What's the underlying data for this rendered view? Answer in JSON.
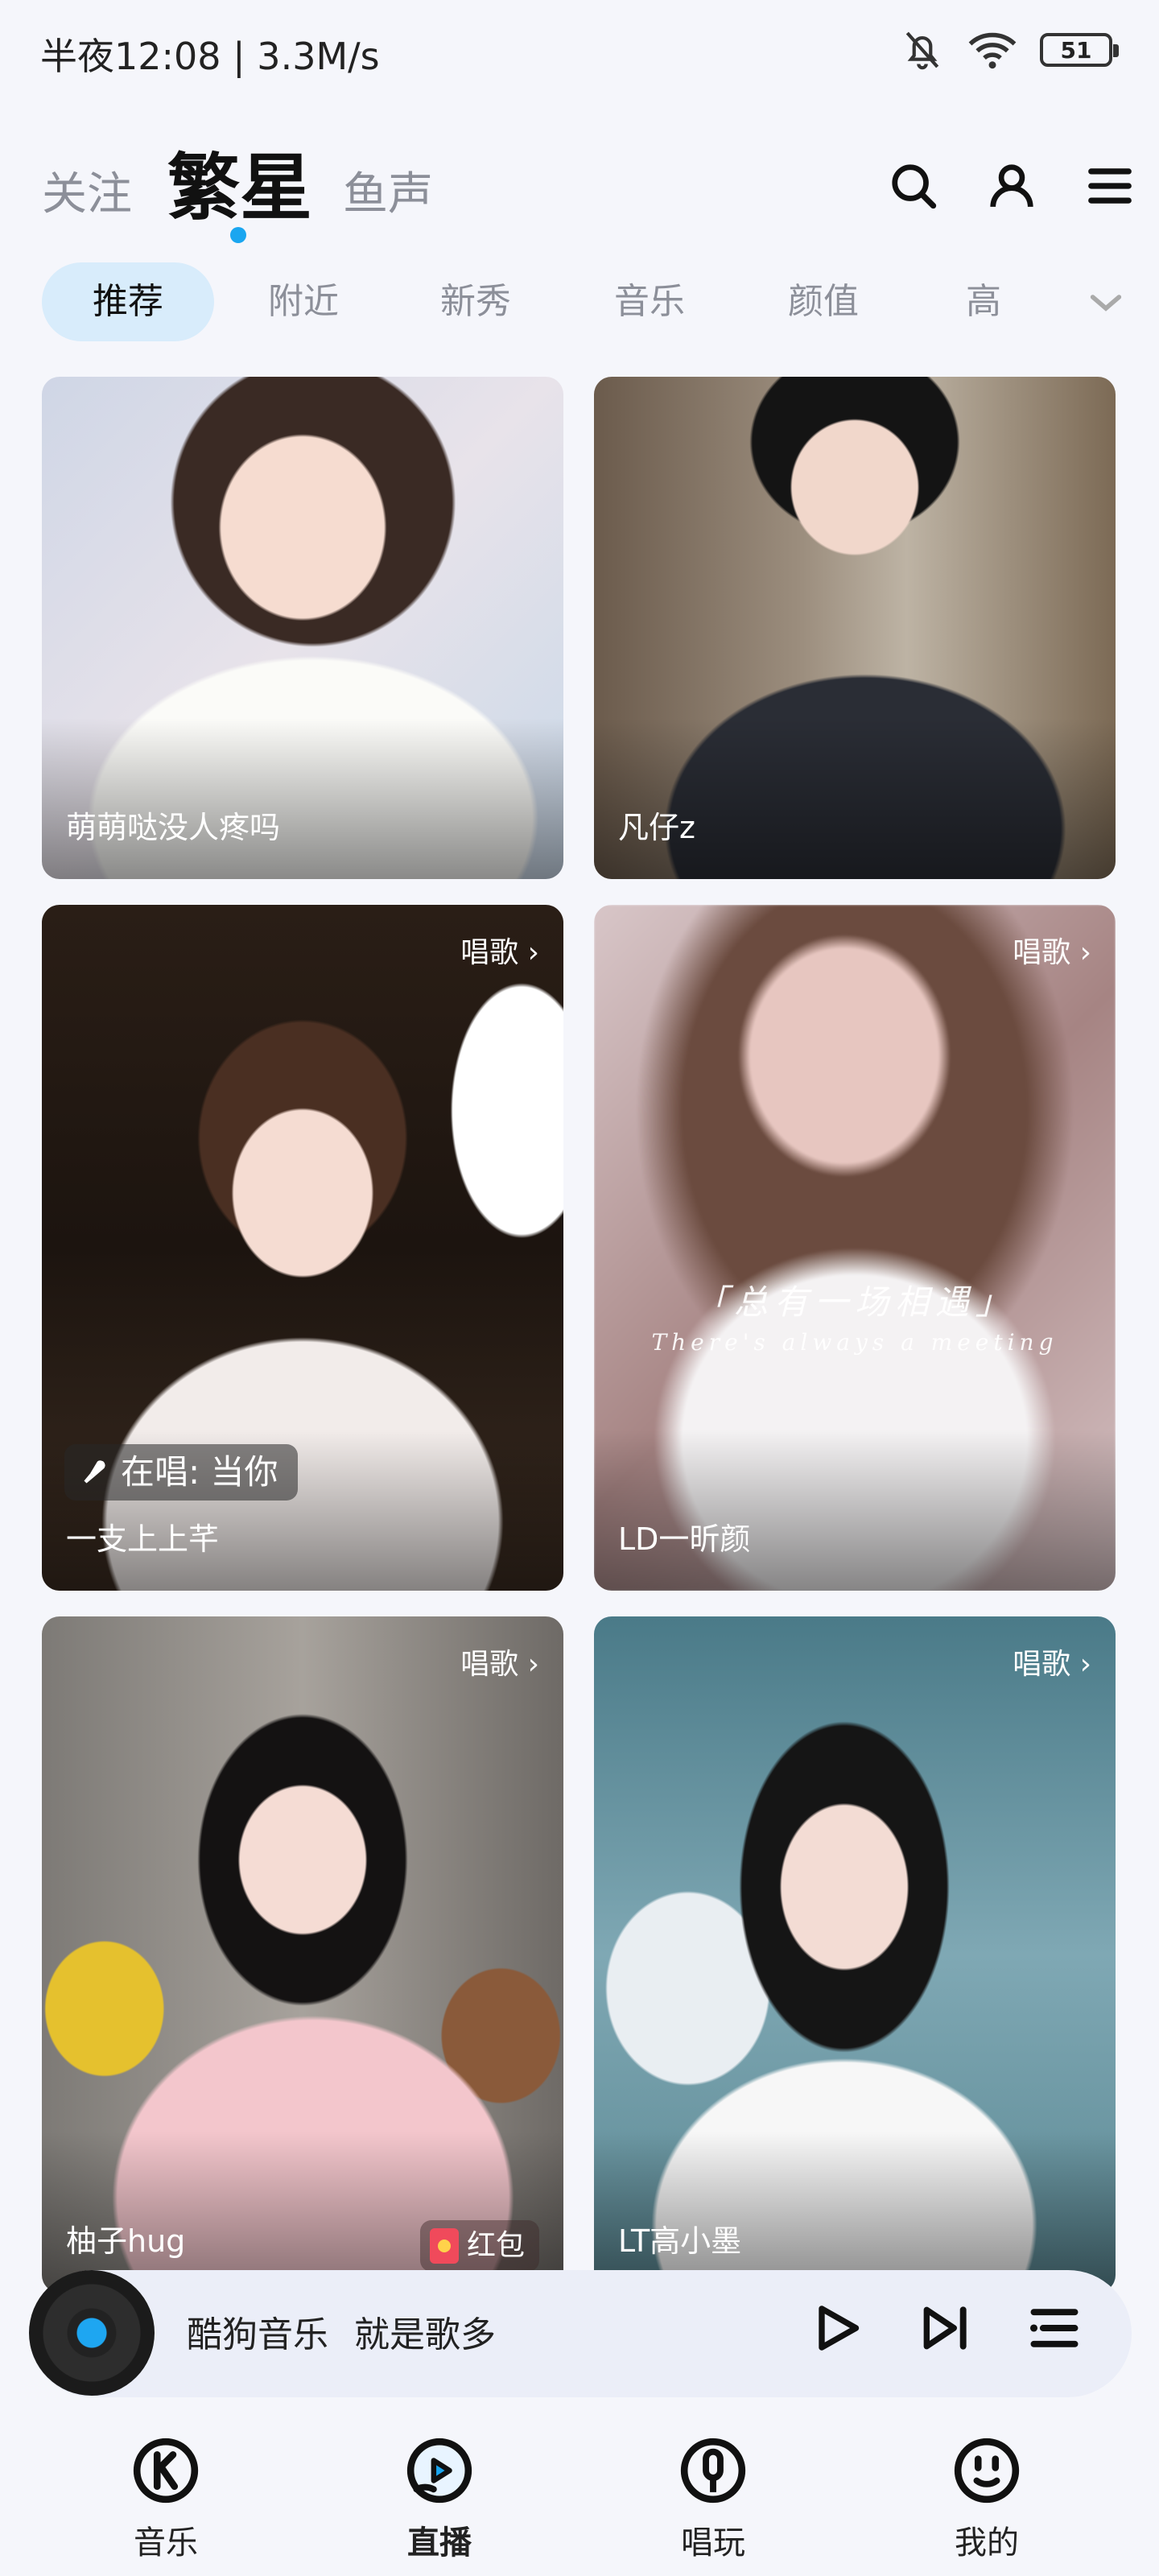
{
  "status_bar": {
    "time_speed": "半夜12:08 | 3.3M/s",
    "battery": "51"
  },
  "top_tabs": {
    "follow": "关注",
    "stars": "繁星",
    "fish": "鱼声"
  },
  "categories": {
    "items": [
      "推荐",
      "附近",
      "新秀",
      "音乐",
      "颜值",
      "高"
    ]
  },
  "cards": [
    {
      "name": "萌萌哒没人疼吗",
      "tag": ""
    },
    {
      "name": "凡仔z",
      "tag": ""
    },
    {
      "name": "一支上上芊",
      "tag": "唱歌 ›",
      "singing": "在唱: 当你"
    },
    {
      "name": "LD一昕颜",
      "tag": "唱歌 ›",
      "overlay_line1": "「总有一场相遇」",
      "overlay_line2": "There's always a meeting"
    },
    {
      "name": "柚子hug",
      "tag": "唱歌 ›",
      "badge": "红包"
    },
    {
      "name": "LT高小墨",
      "tag": "唱歌 ›"
    }
  ],
  "player": {
    "app": "酷狗音乐",
    "track": "就是歌多"
  },
  "bottom_nav": {
    "items": [
      {
        "label": "音乐",
        "icon": "k-logo-icon"
      },
      {
        "label": "直播",
        "icon": "live-play-icon"
      },
      {
        "label": "唱玩",
        "icon": "mic-circle-icon"
      },
      {
        "label": "我的",
        "icon": "smiley-icon"
      }
    ]
  },
  "colors": {
    "accent": "#1aa6f0",
    "chip_active_bg": "#d8ecfb",
    "background": "#f5f6fb"
  }
}
